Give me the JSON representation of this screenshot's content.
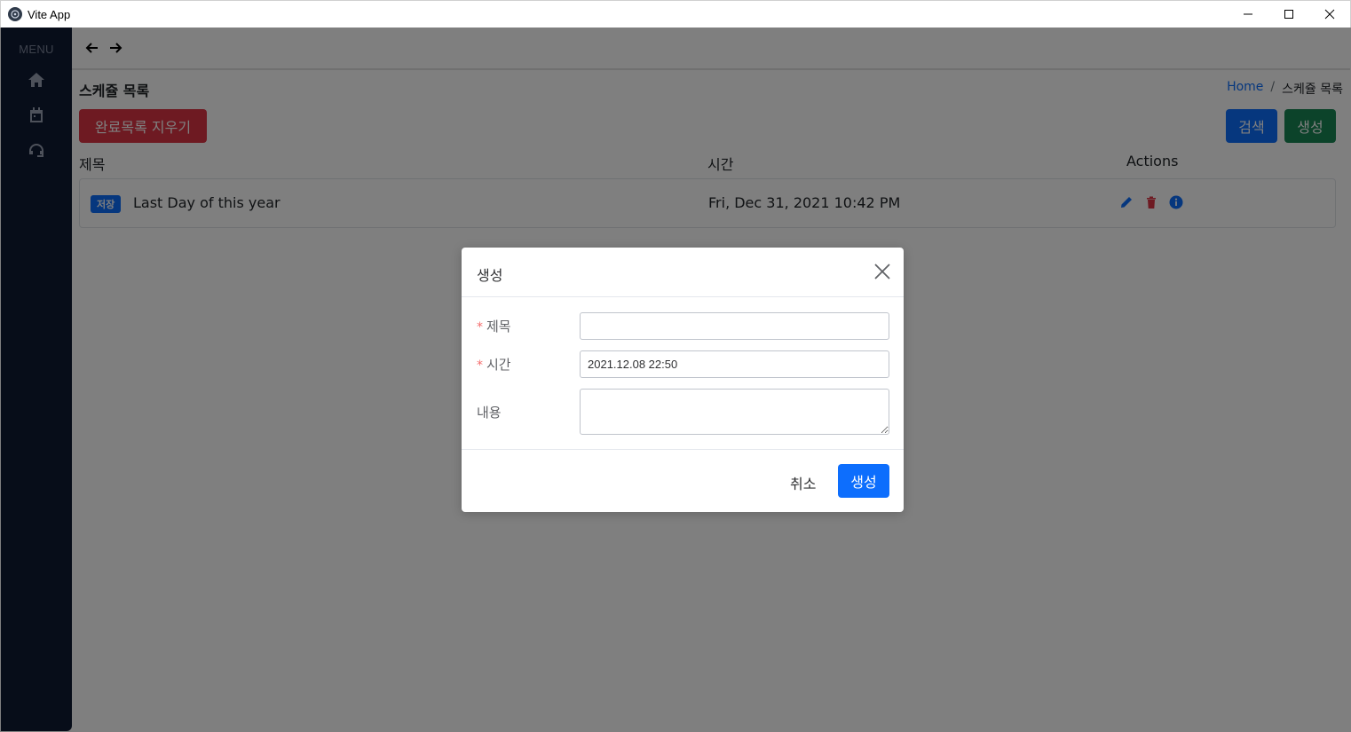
{
  "window": {
    "title": "Vite App"
  },
  "sidebar": {
    "menu_label": "MENU",
    "items": [
      {
        "icon": "home-icon"
      },
      {
        "icon": "calendar-icon"
      },
      {
        "icon": "support-icon"
      }
    ]
  },
  "page": {
    "title": "스케쥴 목록",
    "breadcrumb": {
      "home": "Home",
      "sep": "/",
      "current": "스케쥴 목록"
    },
    "buttons": {
      "clear_done": "완료목록 지우기",
      "search": "검색",
      "create": "생성"
    },
    "table": {
      "headers": {
        "title": "제목",
        "time": "시간",
        "actions": "Actions"
      },
      "rows": [
        {
          "badge": "저장",
          "title": "Last Day of this year",
          "time": "Fri, Dec 31, 2021 10:42 PM"
        }
      ]
    }
  },
  "modal": {
    "title": "생성",
    "fields": {
      "title_label": "제목",
      "title_value": "",
      "time_label": "시간",
      "time_value": "2021.12.08 22:50",
      "content_label": "내용",
      "required_mark": "*"
    },
    "cancel": "취소",
    "submit": "생성"
  },
  "colors": {
    "primary": "#0d6efd",
    "danger": "#dc3545",
    "success": "#198754",
    "sidebar": "#0f1a33"
  }
}
